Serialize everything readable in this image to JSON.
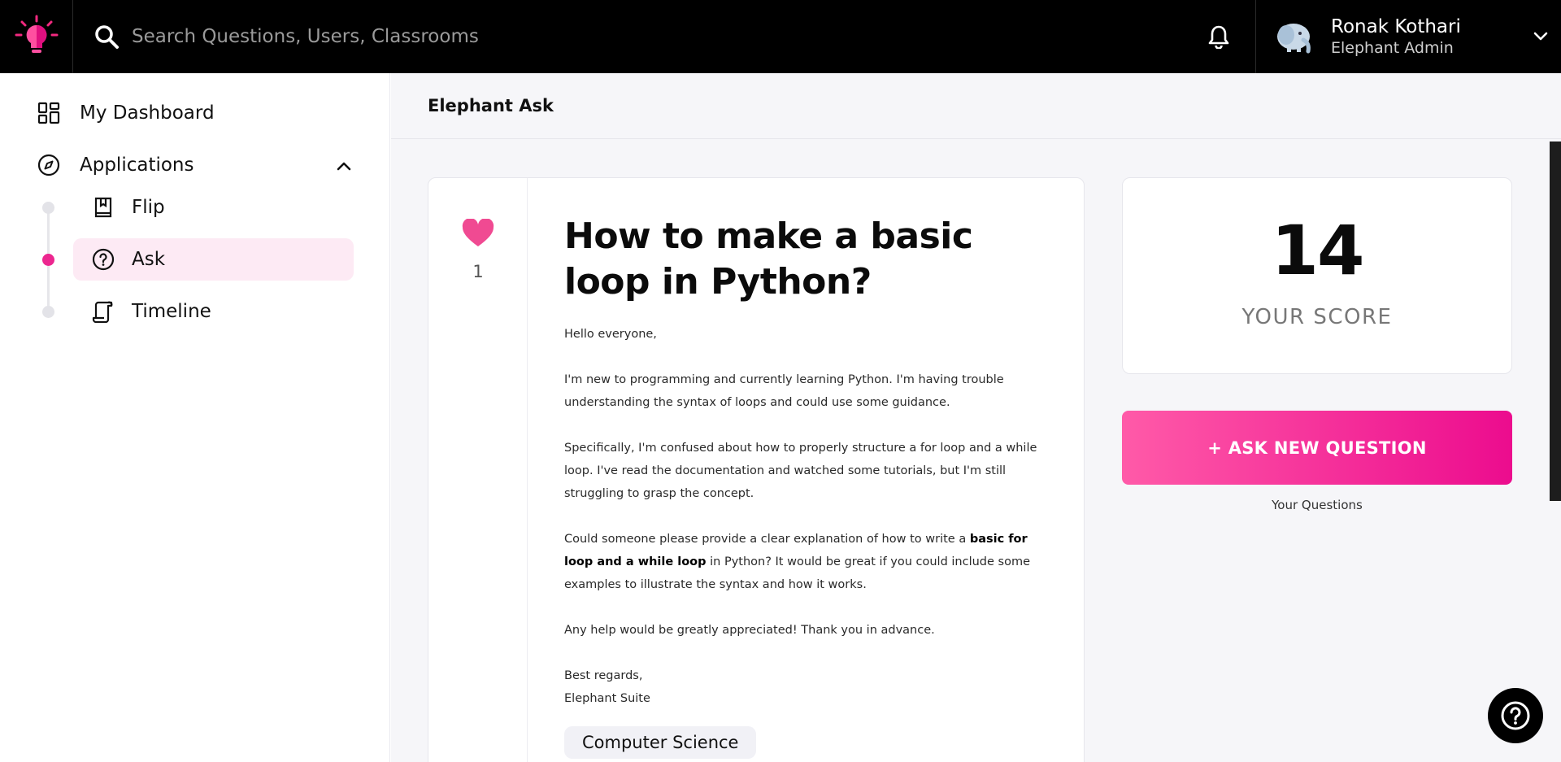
{
  "header": {
    "search_placeholder": "Search Questions, Users, Classrooms",
    "user_name": "Ronak Kothari",
    "user_role": "Elephant Admin"
  },
  "sidebar": {
    "dashboard": "My Dashboard",
    "applications": "Applications",
    "apps": [
      {
        "label": "Flip",
        "icon": "book-icon"
      },
      {
        "label": "Ask",
        "icon": "question-circle-icon",
        "active": true
      },
      {
        "label": "Timeline",
        "icon": "scroll-icon"
      }
    ]
  },
  "page": {
    "breadcrumb": "Elephant Ask"
  },
  "question": {
    "likes": "1",
    "title": "How to make a basic loop in Python?",
    "greeting": "Hello everyone,",
    "para1": "I'm new to programming and currently learning Python. I'm having trouble understanding the syntax of loops and could use some guidance.",
    "para2": "Specifically, I'm confused about how to properly structure a for loop and a while loop. I've read the documentation and watched some tutorials, but I'm still struggling to grasp the concept.",
    "para3_start": "Could someone please provide a clear explanation of how to write a ",
    "para3_bold": "basic for loop and a while loop",
    "para3_end": " in Python? It would be great if you could include some examples to illustrate the syntax and how it works.",
    "para4": "Any help would be greatly appreciated! Thank you in advance.",
    "signoff": "Best regards,",
    "signature": "Elephant Suite",
    "tag": "Computer Science"
  },
  "score": {
    "value": "14",
    "label": "YOUR SCORE"
  },
  "actions": {
    "ask_button": "+ ASK NEW QUESTION",
    "your_questions": "Your Questions"
  },
  "colors": {
    "accent": "#ec268f",
    "topbar": "#000000",
    "main_bg": "#f6f6f9"
  }
}
